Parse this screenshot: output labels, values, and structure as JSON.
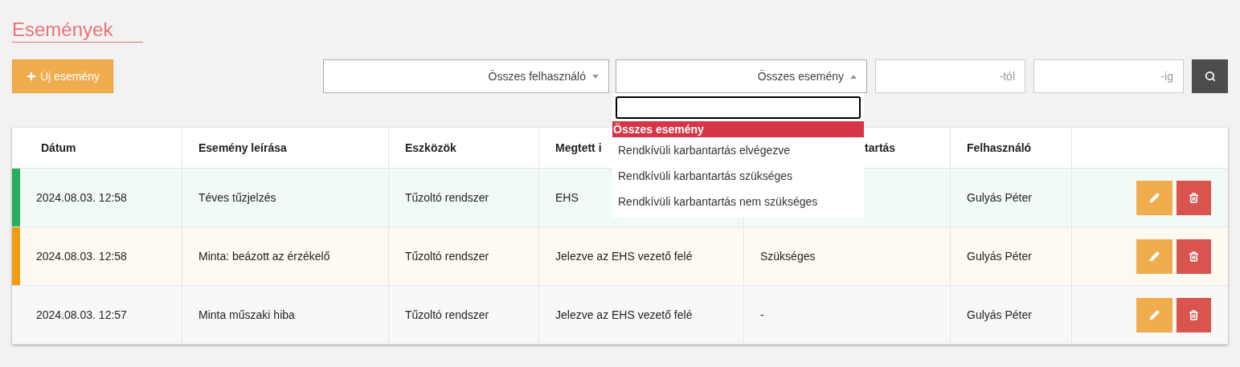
{
  "title": "Események",
  "new_button": {
    "label": "Új esemény"
  },
  "filters": {
    "user_select": {
      "value": "Összes felhasználó",
      "open": false
    },
    "event_select": {
      "value": "Összes esemény",
      "open": true,
      "options": [
        {
          "label": "Összes esemény",
          "selected": true
        },
        {
          "label": "Rendkívüli karbantartás elvégezve",
          "selected": false
        },
        {
          "label": "Rendkívüli karbantartás szükséges",
          "selected": false
        },
        {
          "label": "Rendkívüli karbantartás nem szükséges",
          "selected": false
        }
      ]
    },
    "from": {
      "placeholder": "-tól"
    },
    "to": {
      "placeholder": "-ig"
    }
  },
  "table": {
    "columns": [
      "Dátum",
      "Esemény leírása",
      "Eszközök",
      "Megtett i",
      "tartás",
      "Felhasználó"
    ],
    "rows": [
      {
        "color": "#27ae60",
        "cells": [
          "2024.08.03. 12:58",
          "Téves tűzjelzés",
          "Tűzoltó rendszer",
          "EHS",
          "",
          "Gulyás Péter"
        ]
      },
      {
        "color": "#f39c12",
        "cells": [
          "2024.08.03. 12:58",
          "Minta: beázott az érzékelő",
          "Tűzoltó rendszer",
          "Jelezve az EHS vezető felé",
          "Szükséges",
          "Gulyás Péter"
        ]
      },
      {
        "cells": [
          "2024.08.03. 12:57",
          "Minta műszaki hiba",
          "Tűzoltó rendszer",
          "Jelezve az EHS vezető felé",
          "-",
          "Gulyás Péter"
        ]
      }
    ]
  }
}
